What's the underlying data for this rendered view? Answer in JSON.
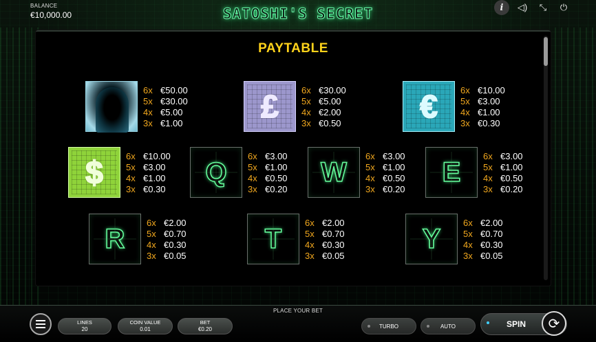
{
  "header": {
    "balance_label": "BALANCE",
    "balance_value": "€10,000.00",
    "game_title": "SATOSHI'S SECRET"
  },
  "top_icons": [
    "info-icon",
    "sound-icon",
    "fullscreen-icon",
    "power-icon"
  ],
  "paytable": {
    "title": "PAYTABLE",
    "symbols": [
      {
        "id": "hacker",
        "pays": [
          [
            "6x",
            "€50.00"
          ],
          [
            "5x",
            "€30.00"
          ],
          [
            "4x",
            "€5.00"
          ],
          [
            "3x",
            "€1.00"
          ]
        ]
      },
      {
        "id": "pound",
        "glyph": "£",
        "pays": [
          [
            "6x",
            "€30.00"
          ],
          [
            "5x",
            "€5.00"
          ],
          [
            "4x",
            "€2.00"
          ],
          [
            "3x",
            "€0.50"
          ]
        ]
      },
      {
        "id": "euro",
        "glyph": "€",
        "pays": [
          [
            "6x",
            "€10.00"
          ],
          [
            "5x",
            "€3.00"
          ],
          [
            "4x",
            "€1.00"
          ],
          [
            "3x",
            "€0.30"
          ]
        ]
      },
      {
        "id": "dollar",
        "glyph": "$",
        "pays": [
          [
            "6x",
            "€10.00"
          ],
          [
            "5x",
            "€3.00"
          ],
          [
            "4x",
            "€1.00"
          ],
          [
            "3x",
            "€0.30"
          ]
        ]
      },
      {
        "id": "q",
        "glyph": "Q",
        "pays": [
          [
            "6x",
            "€3.00"
          ],
          [
            "5x",
            "€1.00"
          ],
          [
            "4x",
            "€0.50"
          ],
          [
            "3x",
            "€0.20"
          ]
        ]
      },
      {
        "id": "w",
        "glyph": "W",
        "pays": [
          [
            "6x",
            "€3.00"
          ],
          [
            "5x",
            "€1.00"
          ],
          [
            "4x",
            "€0.50"
          ],
          [
            "3x",
            "€0.20"
          ]
        ]
      },
      {
        "id": "e",
        "glyph": "E",
        "pays": [
          [
            "6x",
            "€3.00"
          ],
          [
            "5x",
            "€1.00"
          ],
          [
            "4x",
            "€0.50"
          ],
          [
            "3x",
            "€0.20"
          ]
        ]
      },
      {
        "id": "r",
        "glyph": "R",
        "pays": [
          [
            "6x",
            "€2.00"
          ],
          [
            "5x",
            "€0.70"
          ],
          [
            "4x",
            "€0.30"
          ],
          [
            "3x",
            "€0.05"
          ]
        ]
      },
      {
        "id": "t",
        "glyph": "T",
        "pays": [
          [
            "6x",
            "€2.00"
          ],
          [
            "5x",
            "€0.70"
          ],
          [
            "4x",
            "€0.30"
          ],
          [
            "3x",
            "€0.05"
          ]
        ]
      },
      {
        "id": "y",
        "glyph": "Y",
        "pays": [
          [
            "6x",
            "€2.00"
          ],
          [
            "5x",
            "€0.70"
          ],
          [
            "4x",
            "€0.30"
          ],
          [
            "3x",
            "€0.05"
          ]
        ]
      }
    ]
  },
  "bottom": {
    "place_bet": "PLACE YOUR BET",
    "lines_label": "LINES",
    "lines_value": "20",
    "coin_label": "COIN VALUE",
    "coin_value": "0.01",
    "bet_label": "BET",
    "bet_value": "€0.20",
    "turbo": "TURBO",
    "auto": "AUTO",
    "spin": "SPIN"
  },
  "colors": {
    "title": "#ffd21a",
    "multiplier": "#f2a81e",
    "neon_green": "#67ff9e"
  }
}
